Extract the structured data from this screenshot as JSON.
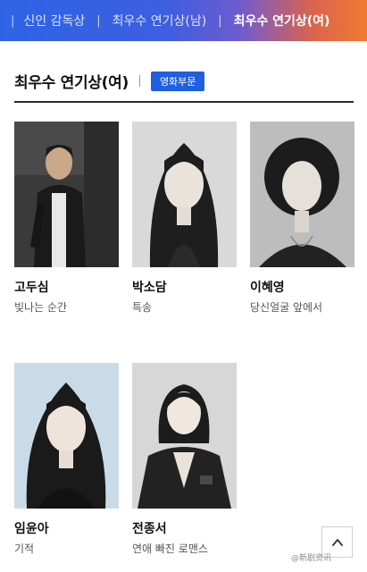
{
  "tabs": [
    {
      "label": "신인 감독상",
      "active": false
    },
    {
      "label": "최우수 연기상(남)",
      "active": false
    },
    {
      "label": "최우수 연기상(여)",
      "active": true
    }
  ],
  "section": {
    "title": "최우수 연기상(여)",
    "badge": "영화부문"
  },
  "nominees": [
    {
      "name": "고두심",
      "work": "빛나는 순간"
    },
    {
      "name": "박소담",
      "work": "특송"
    },
    {
      "name": "이혜영",
      "work": "당신얼굴 앞에서"
    },
    {
      "name": "임윤아",
      "work": "기적"
    },
    {
      "name": "전종서",
      "work": "연애 빠진 로맨스"
    }
  ],
  "scroll_top_icon": "chevron-up-icon",
  "watermark": "@新剧资讯",
  "colors": {
    "badge": "#1f5fe0",
    "gradient_start": "#2f63e6",
    "gradient_end": "#f07a32"
  }
}
